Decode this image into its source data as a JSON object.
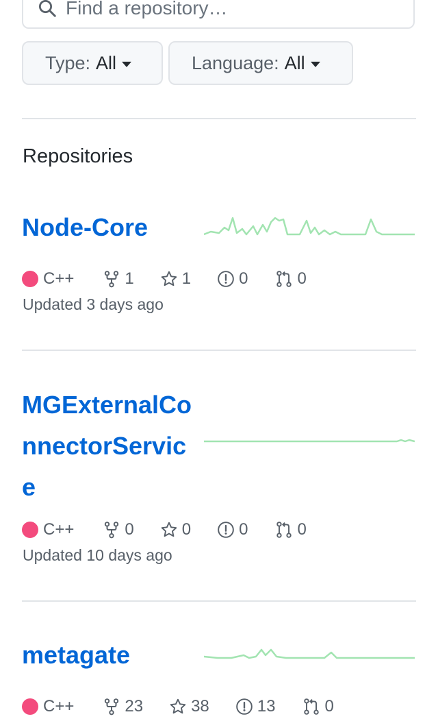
{
  "search": {
    "placeholder": "Find a repository…"
  },
  "filters": {
    "type": {
      "label": "Type:",
      "value": "All"
    },
    "language": {
      "label": "Language:",
      "value": "All"
    }
  },
  "section": {
    "heading": "Repositories"
  },
  "repos": [
    {
      "name": "Node-Core",
      "language": "C++",
      "language_color": "#f34b7d",
      "forks": "1",
      "stars": "1",
      "issues": "0",
      "pulls": "0",
      "updated": "Updated 3 days ago"
    },
    {
      "name_lines": [
        "MGExternalCo",
        "nnectorServic",
        "e"
      ],
      "language": "C++",
      "language_color": "#f34b7d",
      "forks": "0",
      "stars": "0",
      "issues": "0",
      "pulls": "0",
      "updated": "Updated 10 days ago"
    },
    {
      "name": "metagate",
      "language": "C++",
      "language_color": "#f34b7d",
      "forks": "23",
      "stars": "38",
      "issues": "13",
      "pulls": "0"
    }
  ],
  "colors": {
    "link": "#0366d6",
    "sparkline": "#a2e4b1",
    "cpp": "#f34b7d"
  }
}
